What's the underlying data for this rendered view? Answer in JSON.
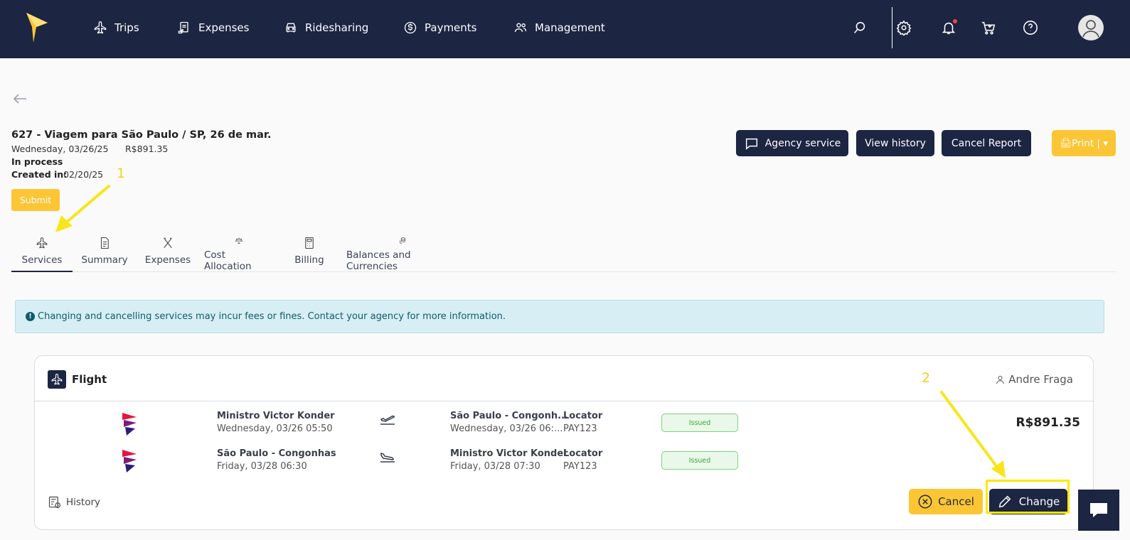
{
  "nav": {
    "items": [
      {
        "label": "Trips",
        "icon": "plane-icon"
      },
      {
        "label": "Expenses",
        "icon": "receipt-icon"
      },
      {
        "label": "Ridesharing",
        "icon": "car-icon"
      },
      {
        "label": "Payments",
        "icon": "dollar-circle-icon"
      },
      {
        "label": "Management",
        "icon": "users-icon"
      }
    ],
    "right_icons": [
      "search-icon",
      "gear-icon",
      "bell-icon",
      "cart-icon",
      "help-icon",
      "avatar"
    ]
  },
  "report": {
    "title": "627 - Viagem para São Paulo / SP, 26 de mar.",
    "date": "Wednesday, 03/26/25",
    "total": "R$891.35",
    "status": "In process",
    "created_label": "Created in:",
    "created_value": "02/20/25",
    "submit_label": "Submit"
  },
  "actions": {
    "agency_service": "Agency service",
    "view_history": "View history",
    "cancel_report": "Cancel Report",
    "print": "🖨Print | ▾"
  },
  "tabs": [
    {
      "label": "Services",
      "icon": "plane-icon",
      "active": true
    },
    {
      "label": "Summary",
      "icon": "document-icon"
    },
    {
      "label": "Expenses",
      "icon": "utensils-icon"
    },
    {
      "label": "Cost Allocation",
      "icon": "scale-icon"
    },
    {
      "label": "Billing",
      "icon": "calculator-icon"
    },
    {
      "label": "Balances and Currencies",
      "icon": "coins-icon"
    }
  ],
  "alert": {
    "icon": "!",
    "text": "Changing and cancelling services may incur fees or fines. Contact your agency for more information."
  },
  "flight_card": {
    "title": "Flight",
    "traveler": "Andre Fraga",
    "price": "R$891.35",
    "segments": [
      {
        "origin": "Ministro Victor Konder",
        "departure": "Wednesday, 03/26 05:50",
        "destination": "São Paulo - Congonh...",
        "arrival": "Wednesday, 03/26 06:...",
        "locator_label": "Locator",
        "locator": "PAY123",
        "status": "Issued",
        "direction": "takeoff-icon"
      },
      {
        "origin": "São Paulo - Congonhas",
        "departure": "Friday, 03/28 06:30",
        "destination": "Ministro Victor Konder",
        "arrival": "Friday, 03/28 07:30",
        "locator_label": "Locator",
        "locator": "PAY123",
        "status": "Issued",
        "direction": "landing-icon"
      }
    ],
    "history_label": "History",
    "cancel_label": "Cancel",
    "change_label": "Change"
  },
  "annotations": {
    "one": "1",
    "two": "2",
    "color": "#f2d31b"
  },
  "colors": {
    "navy": "#1c2541",
    "yellow": "#fcc535",
    "alert_bg": "#d7eef4",
    "issued_green": "#3aa83a"
  }
}
